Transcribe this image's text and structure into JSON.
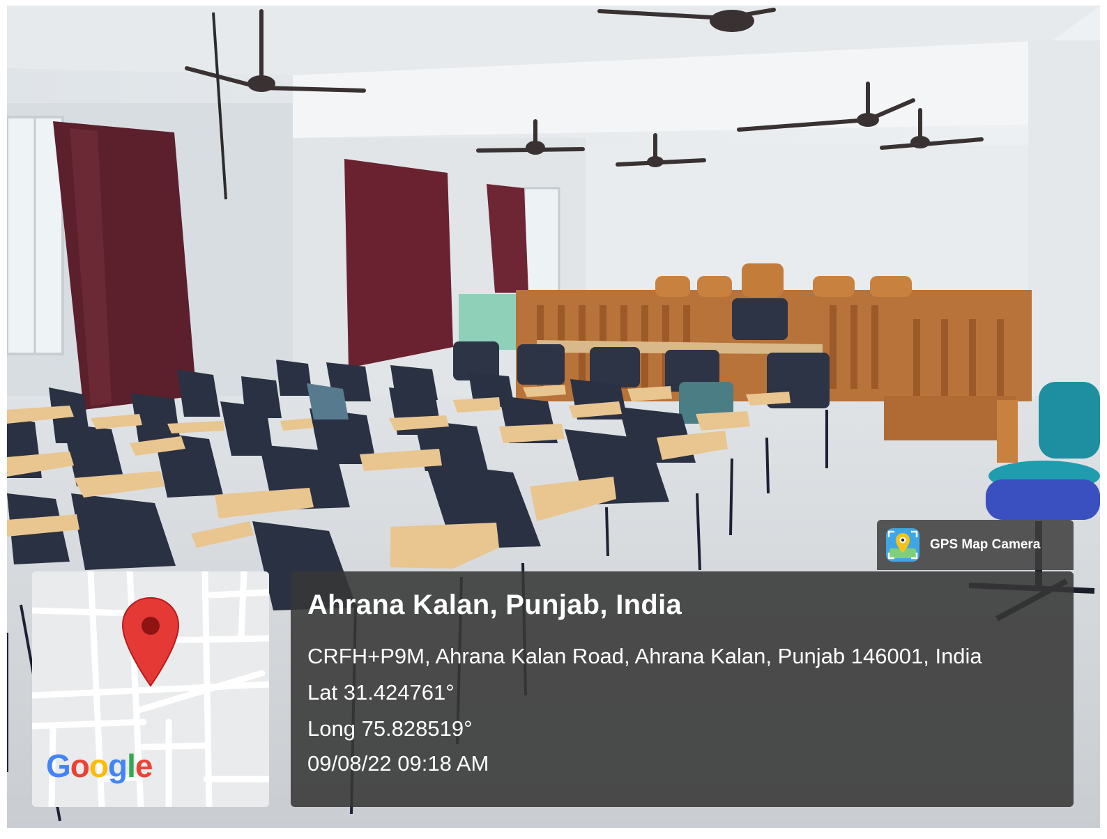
{
  "badge": {
    "label": "GPS Map Camera",
    "icon": "gps-camera-app-icon"
  },
  "map": {
    "logo": "Google",
    "pin_color": "#e53935",
    "icon": "map-pin-icon"
  },
  "location": {
    "title": "Ahrana Kalan, Punjab, India",
    "address": "CRFH+P9M, Ahrana Kalan Road, Ahrana Kalan, Punjab 146001, India",
    "lat": "Lat 31.424761°",
    "long": "Long 75.828519°",
    "datetime": "09/08/22 09:18 AM"
  },
  "colors": {
    "overlay": "#373737",
    "curtain": "#5c1f2c",
    "wood": "#b8733a",
    "chair": "#2c3446",
    "desk": "#e9c58f"
  }
}
